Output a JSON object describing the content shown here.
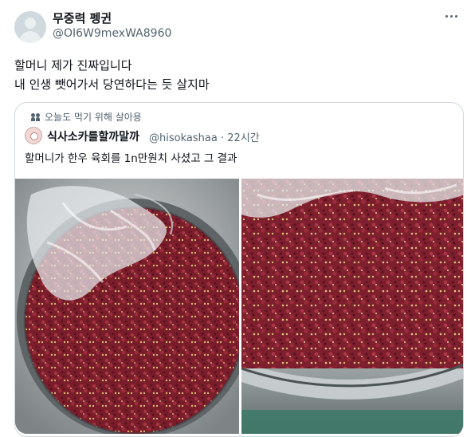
{
  "author": {
    "name": "무중력 펭귄",
    "handle": "@OI6W9mexWA8960"
  },
  "tweet": {
    "line1": "할머니 제가 진짜입니다",
    "line2": "내 인생 뺏어가서 당연하다는 듯 살지마"
  },
  "quote": {
    "social_context": "오늘도 먹기 위해 살아용",
    "author_name": "식사소카를할까말까",
    "author_handle": "@hisokashaa",
    "time": "22시간",
    "text": "할머니가 한우 육회를 1n만원치 사셨고 그 결과",
    "photos": [
      {
        "name": "raw-beef-bowl-photo-1"
      },
      {
        "name": "raw-beef-bowl-photo-2"
      }
    ]
  },
  "colors": {
    "text": "#0f1419",
    "secondary": "#536471",
    "border": "#cfd9de"
  }
}
